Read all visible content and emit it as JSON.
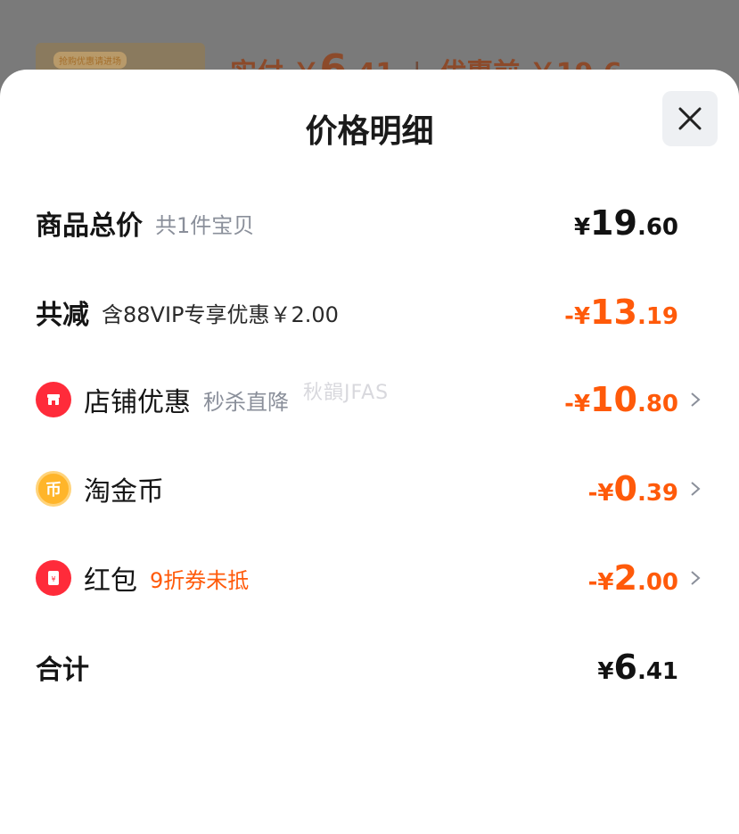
{
  "background": {
    "banner_label": "抢购优惠请进场",
    "actual_pay_label": "实付",
    "actual_pay_currency": "￥",
    "actual_pay_int": "6",
    "actual_pay_dec": ".41",
    "before_discount": "优惠前 ￥19.6"
  },
  "sheet": {
    "title": "价格明细",
    "close_icon": "close-icon"
  },
  "rows": {
    "total": {
      "label": "商品总价",
      "sub": "共1件宝贝",
      "currency": "¥",
      "int": "19",
      "dec": ".60"
    },
    "reduction": {
      "label": "共减",
      "sub": "含88VIP专享优惠￥2.00",
      "currency": "-¥",
      "int": "13",
      "dec": ".19"
    },
    "store": {
      "icon": "store-icon",
      "label": "店铺优惠",
      "sub": "秒杀直降",
      "currency": "-¥",
      "int": "10",
      "dec": ".80"
    },
    "coin": {
      "icon": "coin-icon",
      "icon_char": "币",
      "label": "淘金币",
      "currency": "-¥",
      "int": "0",
      "dec": ".39"
    },
    "redpacket": {
      "icon": "red-packet-icon",
      "label": "红包",
      "sub": "9折券未抵",
      "currency": "-¥",
      "int": "2",
      "dec": ".00"
    },
    "sum": {
      "label": "合计",
      "currency": "¥",
      "int": "6",
      "dec": ".41"
    }
  },
  "watermark": "秋韻JFAS",
  "colors": {
    "accent_orange": "#ff5a0a",
    "store_red": "#ff2b3a",
    "coin_gold": "#ffb52a"
  }
}
